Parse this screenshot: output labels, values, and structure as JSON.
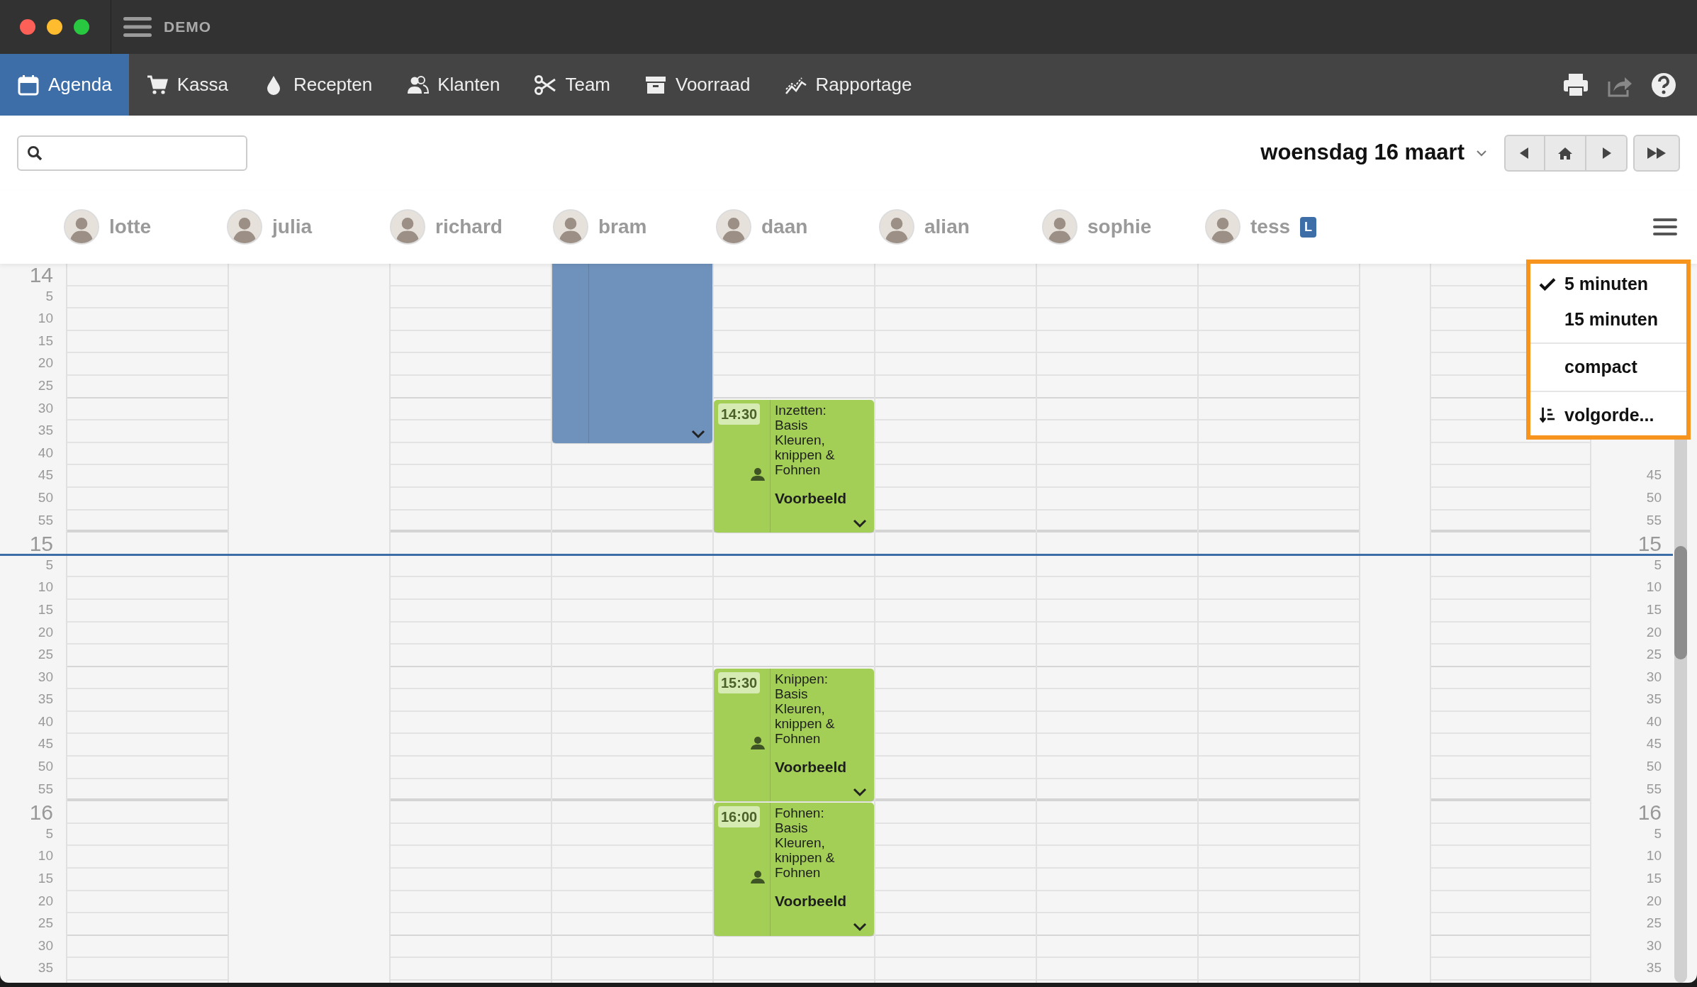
{
  "window": {
    "title": "DEMO"
  },
  "nav": {
    "items": [
      {
        "label": "Agenda",
        "selected": true
      },
      {
        "label": "Kassa",
        "selected": false
      },
      {
        "label": "Recepten",
        "selected": false
      },
      {
        "label": "Klanten",
        "selected": false
      },
      {
        "label": "Team",
        "selected": false
      },
      {
        "label": "Voorraad",
        "selected": false
      },
      {
        "label": "Rapportage",
        "selected": false
      }
    ]
  },
  "toolbar": {
    "date": "woensdag 16 maart"
  },
  "schedule": {
    "left_labels": [
      "14",
      "5",
      "10",
      "15",
      "20",
      "25",
      "30",
      "35",
      "40",
      "45",
      "50",
      "55",
      "15",
      "5",
      "10",
      "15",
      "20",
      "25",
      "30",
      "35",
      "40",
      "45",
      "50",
      "55",
      "16",
      "5",
      "10",
      "15",
      "20",
      "25",
      "30",
      "35"
    ],
    "right_labels": [
      "45",
      "50",
      "55",
      "15",
      "5",
      "10",
      "15",
      "20",
      "25",
      "30",
      "35",
      "40",
      "45",
      "50",
      "55",
      "16",
      "5",
      "10",
      "15",
      "20",
      "25",
      "30",
      "35"
    ],
    "columns": [
      {
        "kind": "staff",
        "name": "lotte"
      },
      {
        "kind": "off",
        "name": "julia"
      },
      {
        "kind": "staff",
        "name": "richard"
      },
      {
        "kind": "staff",
        "name": "bram",
        "events": [
          {
            "kind": "block",
            "color": "#6f92bc"
          }
        ]
      },
      {
        "kind": "staff",
        "name": "daan",
        "events": [
          {
            "kind": "appointment",
            "color": "#a3cf57",
            "time": "14:30",
            "description": "Inzetten: Basis Kleuren, knippen & Fohnen",
            "customer": "Voorbeeld"
          },
          {
            "kind": "appointment",
            "color": "#a3cf57",
            "time": "15:30",
            "description": "Knippen: Basis Kleuren, knippen & Fohnen",
            "customer": "Voorbeeld"
          },
          {
            "kind": "appointment",
            "color": "#a3cf57",
            "time": "16:00",
            "description": "Fohnen: Basis Kleuren, knippen & Fohnen",
            "customer": "Voorbeeld"
          }
        ]
      },
      {
        "kind": "staff",
        "name": "alian"
      },
      {
        "kind": "staff",
        "name": "sophie"
      },
      {
        "kind": "staff",
        "name": "tess",
        "badge": "L"
      },
      {
        "kind": "spacer"
      },
      {
        "kind": "staff"
      }
    ]
  },
  "view_menu": {
    "items": [
      {
        "kind": "option",
        "label": "5 minuten",
        "checked": true
      },
      {
        "kind": "option",
        "label": "15 minuten",
        "checked": false
      },
      {
        "kind": "divider"
      },
      {
        "kind": "option",
        "label": "compact",
        "checked": false
      },
      {
        "kind": "divider"
      },
      {
        "kind": "action",
        "label": "volgorde..."
      }
    ]
  }
}
